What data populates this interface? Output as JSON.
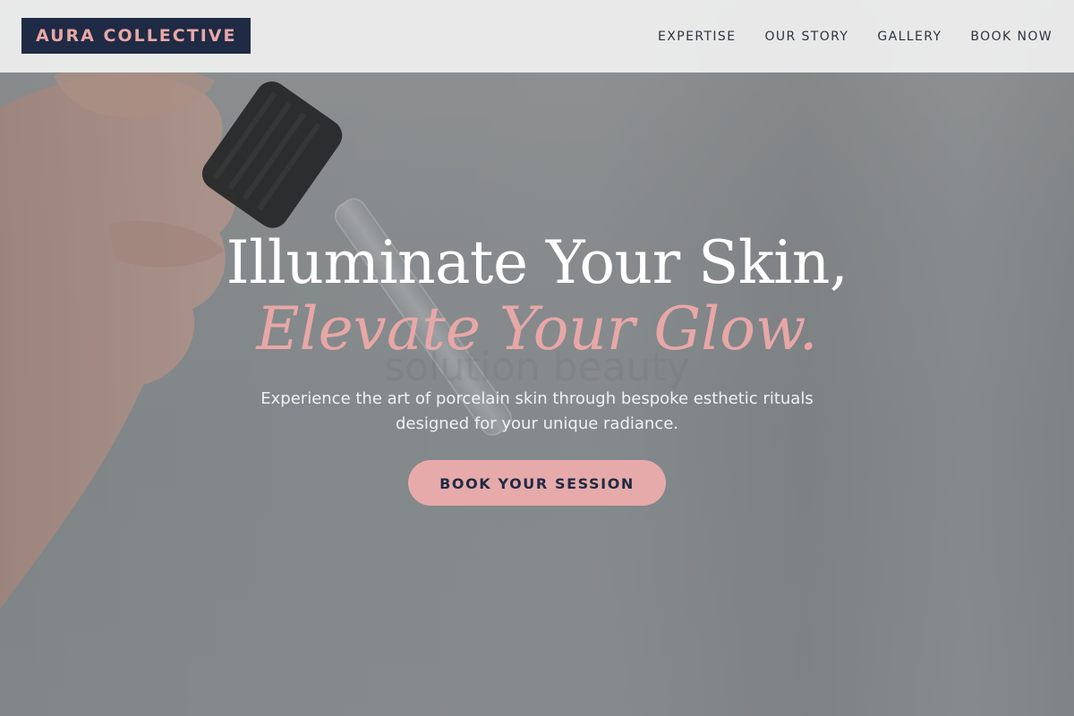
{
  "header": {
    "brand": "AURA COLLECTIVE",
    "nav": [
      {
        "label": "EXPERTISE"
      },
      {
        "label": "OUR STORY"
      },
      {
        "label": "GALLERY"
      },
      {
        "label": "BOOK NOW"
      }
    ]
  },
  "hero": {
    "headline_line1": "Illuminate Your Skin,",
    "headline_line2": "Elevate Your Glow.",
    "subtext": "Experience the art of porcelain skin through bespoke esthetic rituals designed for your unique radiance.",
    "cta_label": "BOOK YOUR SESSION"
  },
  "colors": {
    "brand_bg": "#1f2a44",
    "accent_pink": "#e8a7a7",
    "nav_bg": "#ececec"
  }
}
